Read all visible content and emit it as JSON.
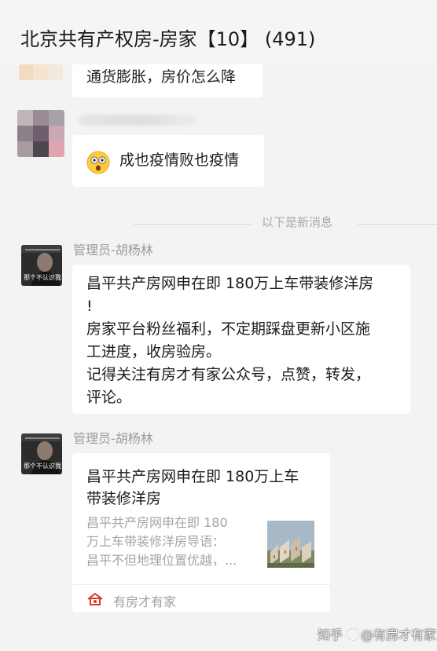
{
  "header": {
    "title": "北京共有产权房-房家【10】 (491)"
  },
  "messages": {
    "partial_top": {
      "text": "通货膨胀，房价怎么降"
    },
    "emoji_message": {
      "text": "成也疫情败也疫情",
      "emoji": "astonished-face-icon"
    },
    "divider": {
      "label": "以下是新消息"
    },
    "admin_text": {
      "sender": "管理员-胡杨林",
      "lines": [
        "昌平共产房网申在即 180万上车带装修洋房",
        "!",
        "房家平台粉丝福利，不定期踩盘更新小区施",
        "工进度，收房验房。",
        "记得关注有房才有家公众号，点赞，转发，",
        "评论。"
      ]
    },
    "admin_card": {
      "sender": "管理员-胡杨林",
      "title_lines": [
        "昌平共产房网申在即 180万上车",
        "带装修洋房"
      ],
      "desc_lines": [
        "昌平共产房网申在即 180",
        "万上车带装修洋房导语：",
        "昌平不但地理位置优越，..."
      ],
      "source": "有房才有家"
    }
  },
  "avatar_overlay_text": "那个不认识我",
  "watermark": {
    "site": "知乎",
    "account": "@有房才有家"
  },
  "colors": {
    "background": "#f3f3f3",
    "bubble": "#ffffff",
    "muted_text": "#9b9b9b"
  }
}
